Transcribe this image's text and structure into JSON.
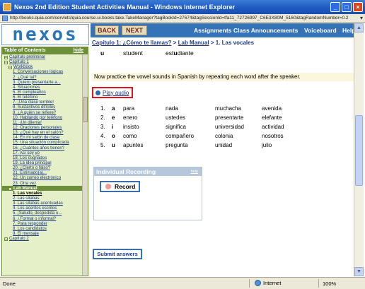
{
  "window": {
    "title": "Nexos 2nd Edition Student Activities Manual - Windows Internet Explorer",
    "url": "http://books.quia.com/servlets/quia.course.ui.books.take.TakeManager?tagBookId=27674&tagSessionId=tfa11_72726997_C6E3X80M_5160&tagRandomNumber=0.2",
    "buttons": {
      "min": "_",
      "max": "□",
      "close": "×"
    }
  },
  "header": {
    "logo": "nexos",
    "back_label": "BACK",
    "next_label": "NEXT",
    "nav": [
      "Assignments",
      "Class Announcements",
      "Voiceboard",
      "Help"
    ]
  },
  "breadcrumb": {
    "chapter": "Capítulo 1: ¿Cómo te llamas?",
    "sep1": ">",
    "section": "Lab Manual",
    "sep2": ">",
    "current": "1. Las vocales"
  },
  "sidebar": {
    "title": "Table of Contents",
    "hide": "hide",
    "items": [
      {
        "label": "Capítulo preliminar",
        "level": 0,
        "box": "+"
      },
      {
        "label": "Capítulo 1",
        "level": 0,
        "box": "−"
      },
      {
        "label": "Workbook",
        "level": 1,
        "box": "−"
      },
      {
        "label": "1. Conversaciones lógicas",
        "level": 2
      },
      {
        "label": "2. ¿Qué tal?",
        "level": 2
      },
      {
        "label": "3. Quiero presentarte a...",
        "level": 2
      },
      {
        "label": "4. Situaciones",
        "level": 2
      },
      {
        "label": "5. El cumpleaños",
        "level": 2
      },
      {
        "label": "6. El teléfono",
        "level": 2
      },
      {
        "label": "7. ¡Una clase terrible!",
        "level": 2
      },
      {
        "label": "8. Sustantivos difíciles",
        "level": 2
      },
      {
        "label": "9. ¿A quién se refiere?",
        "level": 2
      },
      {
        "label": "10. Hablando por teléfono",
        "level": 2
      },
      {
        "label": "11. ¡Un dilema!",
        "level": 2
      },
      {
        "label": "12. Oraciones personales",
        "level": 2
      },
      {
        "label": "13. ¿Qué hay en el salón?",
        "level": 2
      },
      {
        "label": "14. En mi salón de clase",
        "level": 2
      },
      {
        "label": "15. Una situación complicada",
        "level": 2
      },
      {
        "label": "16. ¿Cuántos años tienen?",
        "level": 2
      },
      {
        "label": "17. Así soy yo",
        "level": 2
      },
      {
        "label": "18. Los cognados",
        "level": 2
      },
      {
        "label": "19. La idea principal",
        "level": 2
      },
      {
        "label": "20. ¿Cierto o falso?",
        "level": 2
      },
      {
        "label": "21. Estimado(a)...",
        "level": 2
      },
      {
        "label": "22. Un correo electrónico",
        "level": 2
      },
      {
        "label": "23. Otra vez",
        "level": 2
      },
      {
        "label": "Lab Manual",
        "level": 1,
        "box": "−",
        "highlight": true
      },
      {
        "label": "1. Las vocales",
        "level": 2,
        "active": true
      },
      {
        "label": "2. Las sílabas",
        "level": 2
      },
      {
        "label": "3. Las sílabas acentuadas",
        "level": 2
      },
      {
        "label": "4. Los acentos escritos",
        "level": 2
      },
      {
        "label": "5. ¡Saludo, despedida o...",
        "level": 2
      },
      {
        "label": "6. ¿Formal o informal?",
        "level": 2
      },
      {
        "label": "7. Para responder",
        "level": 2
      },
      {
        "label": "8. Los candidatos",
        "level": 2
      },
      {
        "label": "9. El mensaje",
        "level": 2
      },
      {
        "label": "Capítulo 2",
        "level": 0,
        "box": "+"
      }
    ]
  },
  "main": {
    "prev_row": {
      "letter": "u",
      "word1": "student",
      "word2_pre": "est",
      "word2_bold": "u",
      "word2_post": "diante"
    },
    "instruction": "Now practice the vowel sounds in Spanish by repeating each word after the speaker.",
    "play_audio": "Play audio",
    "vowels": [
      {
        "num": "1.",
        "letter": "a",
        "words": [
          "para",
          "nada",
          "muchacha",
          "avenida"
        ]
      },
      {
        "num": "2.",
        "letter": "e",
        "words": [
          "enero",
          "ustedes",
          "presentarte",
          "elefante"
        ]
      },
      {
        "num": "3.",
        "letter": "i",
        "words": [
          "insisto",
          "significa",
          "universidad",
          "actividad"
        ]
      },
      {
        "num": "4.",
        "letter": "o",
        "words": [
          "como",
          "compañero",
          "colonia",
          "nosotros"
        ]
      },
      {
        "num": "5.",
        "letter": "u",
        "words": [
          "apuntes",
          "pregunta",
          "unidad",
          "julio"
        ]
      }
    ],
    "recording": {
      "title": "Individual Recording",
      "help": "help",
      "record_label": "Record"
    },
    "submit_label": "Submit answers"
  },
  "statusbar": {
    "done": "Done",
    "zone": "Internet",
    "zoom": "100%"
  }
}
